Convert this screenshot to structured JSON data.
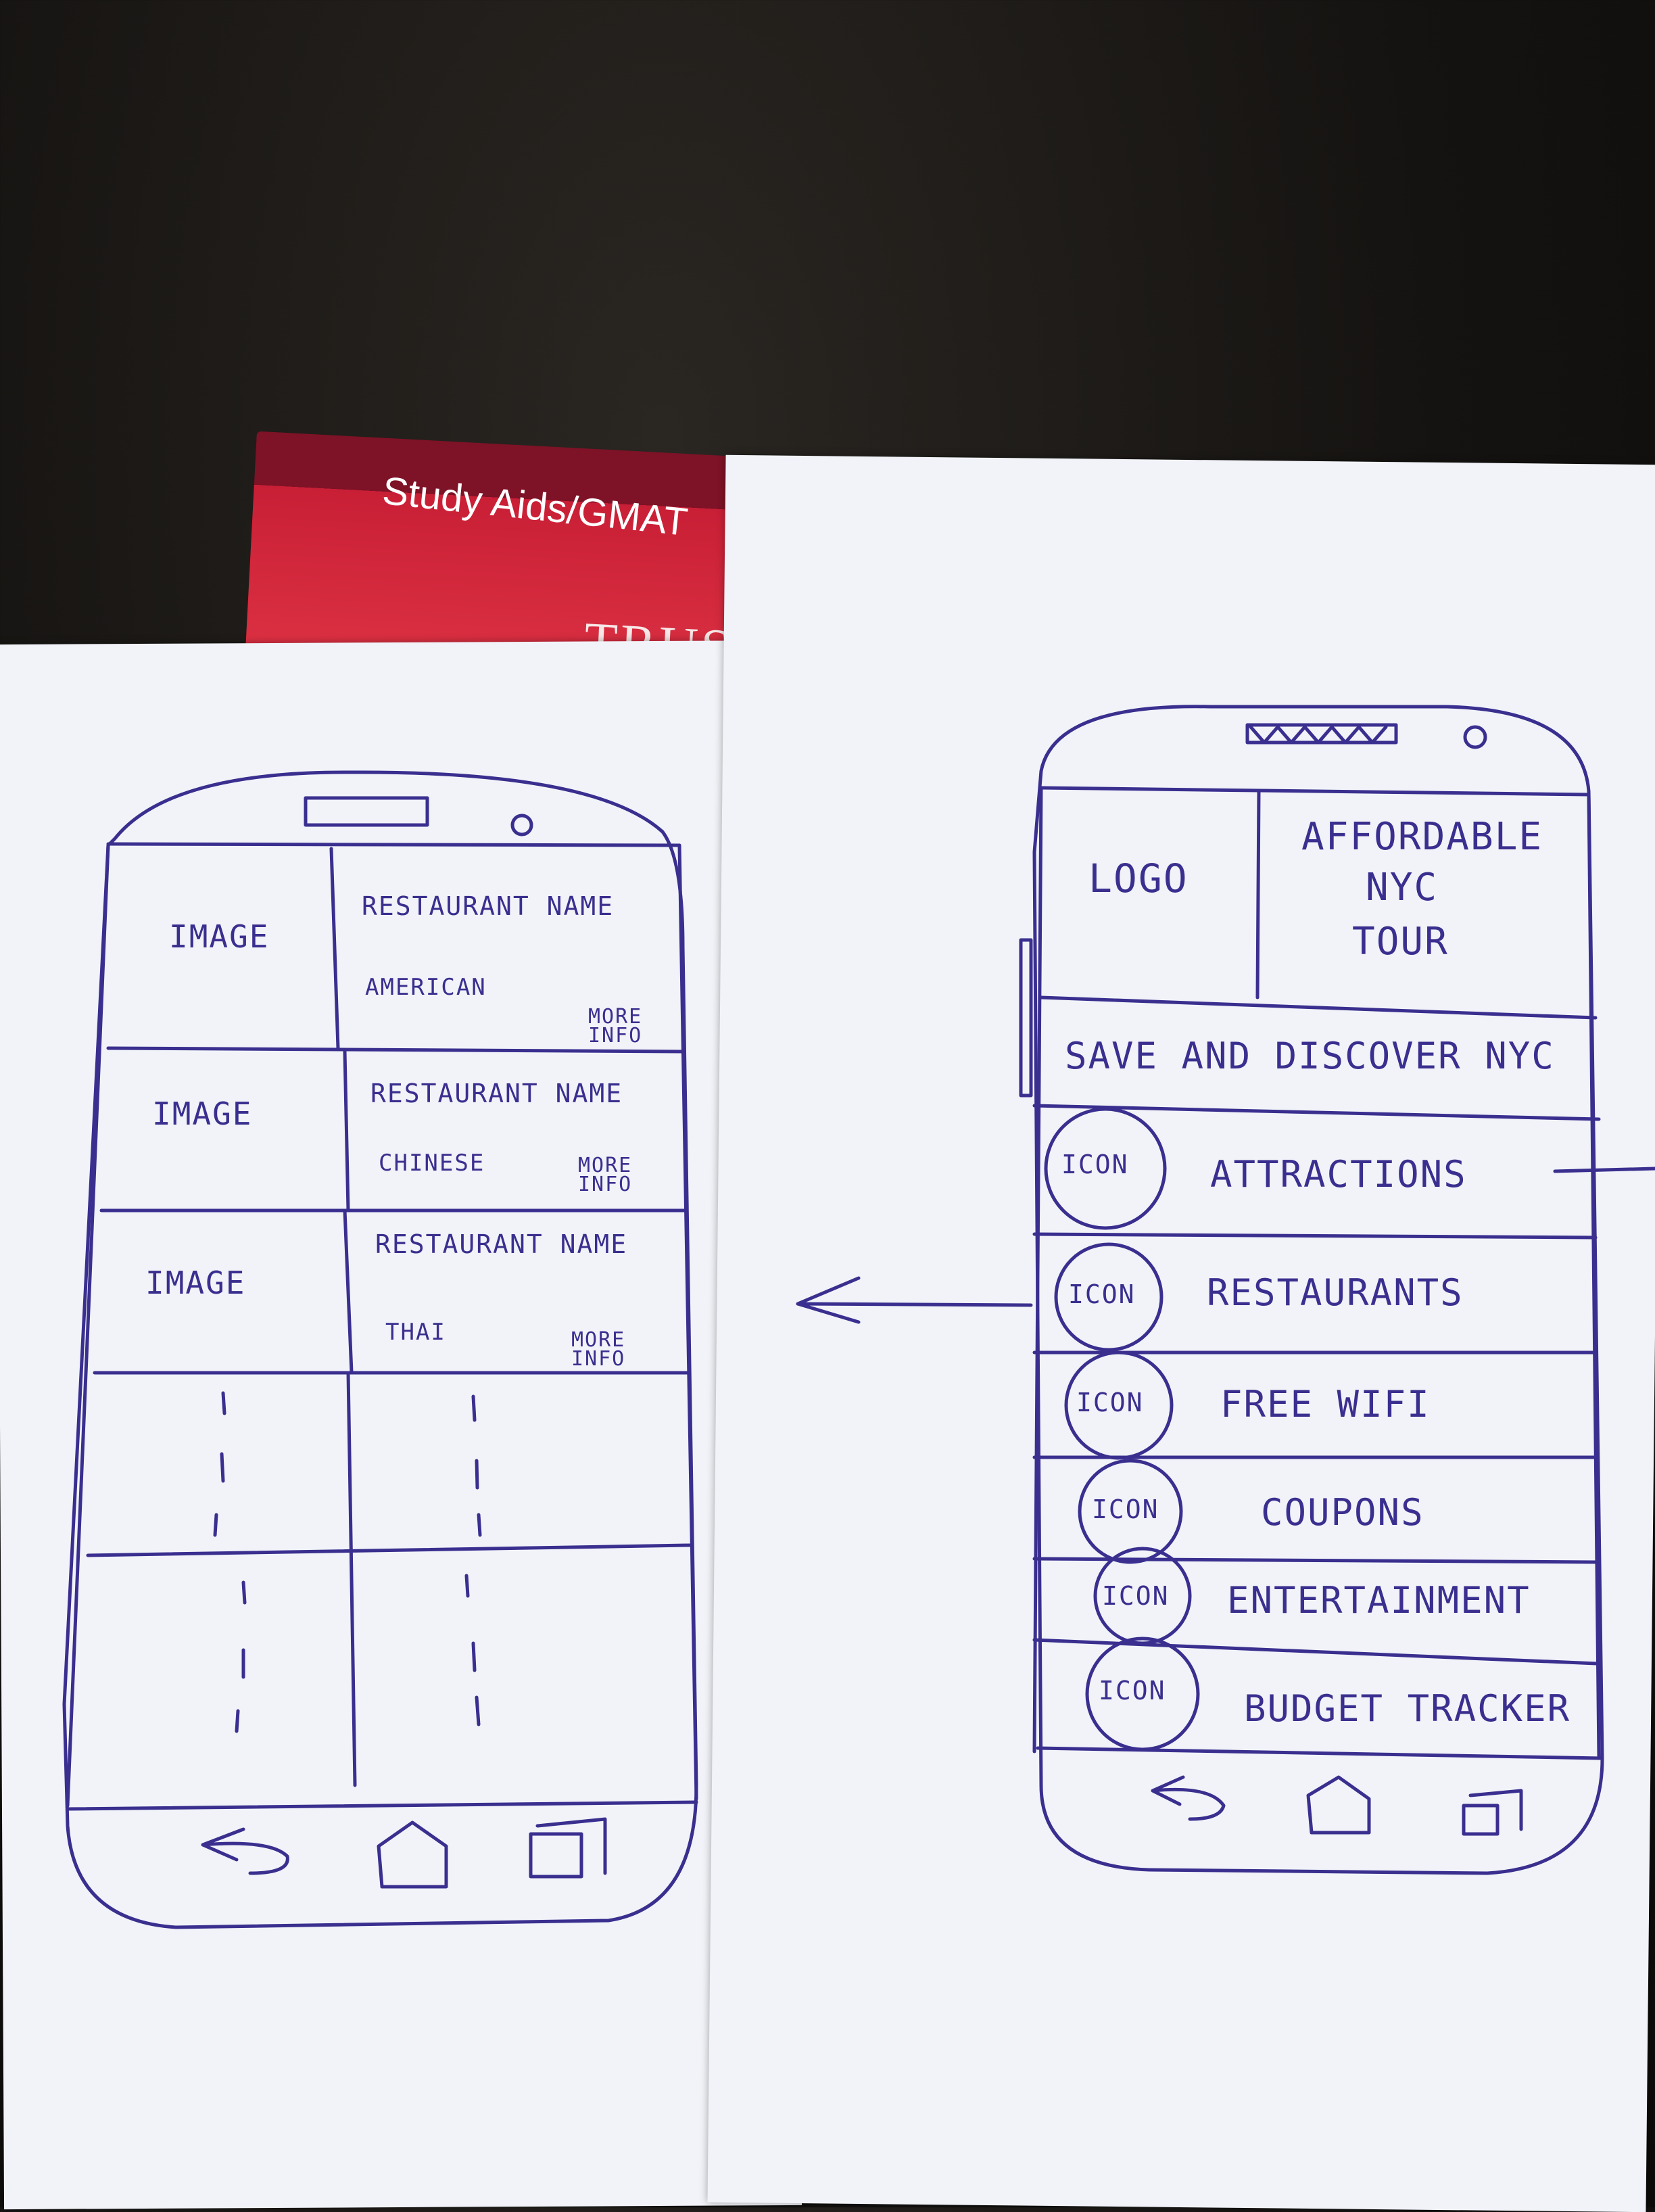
{
  "book": {
    "line1": "Study Aids/GMAT",
    "line2": "TRUST T"
  },
  "left_phone": {
    "rows": [
      {
        "image_label": "IMAGE",
        "name": "RESTAURANT NAME",
        "cuisine": "AMERICAN",
        "more": "MORE INFO"
      },
      {
        "image_label": "IMAGE",
        "name": "RESTAURANT NAME",
        "cuisine": "CHINESE",
        "more": "MORE INFO"
      },
      {
        "image_label": "IMAGE",
        "name": "RESTAURANT NAME",
        "cuisine": "THAI",
        "more": "MORE INFO"
      }
    ],
    "nav_icons": [
      "back-icon",
      "home-icon",
      "recent-apps-icon"
    ]
  },
  "right_phone": {
    "logo": "LOGO",
    "title_lines": [
      "AFFORDABLE",
      "NYC",
      "TOUR"
    ],
    "tagline": "SAVE AND DISCOVER NYC",
    "menu": [
      {
        "icon": "ICON",
        "label": "ATTRACTIONS"
      },
      {
        "icon": "ICON",
        "label": "RESTAURANTS"
      },
      {
        "icon": "ICON",
        "label": "FREE WIFI"
      },
      {
        "icon": "ICON",
        "label": "COUPONS"
      },
      {
        "icon": "ICON",
        "label": "ENTERTAINMENT"
      },
      {
        "icon": "ICON",
        "label": "BUDGET TRACKER"
      }
    ],
    "nav_icons": [
      "back-icon",
      "home-icon",
      "recent-apps-icon"
    ]
  },
  "colors": {
    "ink": "#3a2f8f",
    "paper": "#f1f3f8",
    "book_red": "#d42a3c"
  }
}
